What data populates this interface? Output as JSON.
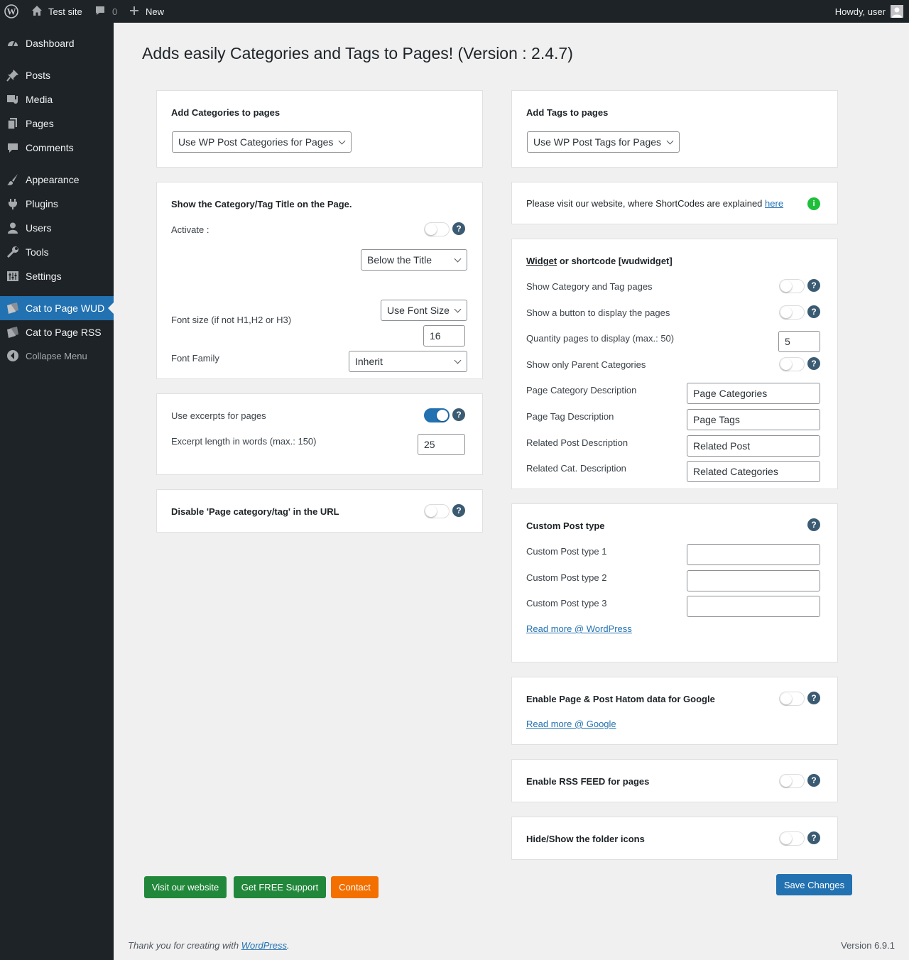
{
  "admin_bar": {
    "site_name": "Test site",
    "comments_count": "0",
    "new_label": "New",
    "greeting": "Howdy, user"
  },
  "sidebar": {
    "items": [
      {
        "label": "Dashboard"
      },
      {
        "label": "Posts"
      },
      {
        "label": "Media"
      },
      {
        "label": "Pages"
      },
      {
        "label": "Comments"
      },
      {
        "label": "Appearance"
      },
      {
        "label": "Plugins"
      },
      {
        "label": "Users"
      },
      {
        "label": "Tools"
      },
      {
        "label": "Settings"
      },
      {
        "label": "Cat to Page WUD"
      },
      {
        "label": "Cat to Page RSS"
      },
      {
        "label": "Collapse Menu"
      }
    ],
    "active": "Cat to Page WUD"
  },
  "page_title": "Adds easily Categories and Tags to Pages! (Version : 2.4.7)",
  "left": {
    "categories": {
      "title": "Add Categories to pages",
      "select_value": "Use WP Post Categories for Pages"
    },
    "title_panel": {
      "title": "Show the Category/Tag Title on the Page.",
      "activate_label": "Activate :",
      "activate_on": false,
      "position_value": "Below the Title",
      "font_size_label": "Font size (if not H1,H2 or H3)",
      "font_size_select": "Use Font Size",
      "font_size_value": "16",
      "font_family_label": "Font Family",
      "font_family_value": "Inherit"
    },
    "excerpt_panel": {
      "use_excerpts_label": "Use excerpts for pages",
      "use_excerpts_on": true,
      "excerpt_length_label": "Excerpt length in words (max.: 150)",
      "excerpt_length_value": "25"
    },
    "disable_url": {
      "label": "Disable 'Page category/tag' in the URL",
      "on": false
    }
  },
  "right": {
    "tags": {
      "title": "Add Tags to pages",
      "select_value": "Use WP Post Tags for Pages"
    },
    "shortcode_info": {
      "text": "Please visit our website, where ShortCodes are explained",
      "link": "here",
      "icon": "i"
    },
    "widget": {
      "title_link": "Widget",
      "title_rest": " or shortcode [wudwidget]",
      "show_cat_tag_label": "Show Category and Tag pages",
      "show_button_label": "Show a button to display the pages",
      "quantity_label": "Quantity pages to display (max.: 50)",
      "quantity_value": "5",
      "parent_only_label": "Show only Parent Categories",
      "page_cat_desc_label": "Page Category Description",
      "page_cat_desc_value": "Page Categories",
      "page_tag_desc_label": "Page Tag Description",
      "page_tag_desc_value": "Page Tags",
      "related_post_label": "Related Post Description",
      "related_post_value": "Related Post",
      "related_cat_label": "Related Cat. Description",
      "related_cat_value": "Related Categories"
    },
    "custom_post": {
      "title": "Custom Post type",
      "type1_label": "Custom Post type 1",
      "type2_label": "Custom Post type 2",
      "type3_label": "Custom Post type 3",
      "read_more": "Read more @ WordPress"
    },
    "hatom": {
      "label": "Enable Page & Post Hatom data for Google",
      "read_more": "Read more @ Google"
    },
    "rss": {
      "label": "Enable RSS FEED for pages"
    },
    "folder_icons": {
      "label": "Hide/Show the folder icons"
    }
  },
  "buttons": {
    "visit": "Visit our website",
    "support": "Get FREE Support",
    "contact": "Contact",
    "save": "Save Changes"
  },
  "footer": {
    "thanks_prefix": "Thank you for creating with ",
    "thanks_link": "WordPress",
    "thanks_suffix": ".",
    "version": "Version 6.9.1"
  },
  "colors": {
    "admin_bar_bg": "#1d2327",
    "active_menu": "#2271b1",
    "toggle_on": "#2271b1",
    "green_button": "#21873a",
    "orange_button": "#f36f00",
    "help_icon": "#3b5b73",
    "info_icon": "#1fbf3a"
  }
}
